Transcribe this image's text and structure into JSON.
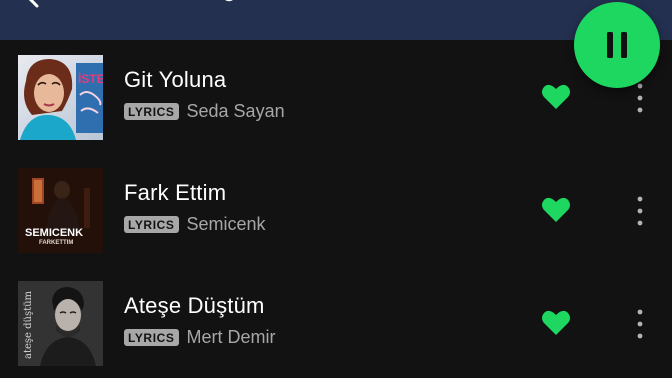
{
  "header": {
    "back_icon": "back-arrow-icon"
  },
  "player": {
    "play_pause_icon": "pause-icon",
    "accent": "#1ed760"
  },
  "tracks": [
    {
      "title": "Git Yoluna",
      "badge": "LYRICS",
      "artist": "Seda Sayan",
      "liked": true,
      "cover_text": "İSTE...",
      "more_icon": "more-vertical-icon"
    },
    {
      "title": "Fark Ettim",
      "badge": "LYRICS",
      "artist": "Semicenk",
      "liked": true,
      "cover_text": "SEMICENK",
      "cover_subtext": "FARKETTIM",
      "more_icon": "more-vertical-icon"
    },
    {
      "title": "Ateşe Düştüm",
      "badge": "LYRICS",
      "artist": "Mert Demir",
      "liked": true,
      "cover_text": "ateşe düştüm",
      "more_icon": "more-vertical-icon"
    }
  ]
}
